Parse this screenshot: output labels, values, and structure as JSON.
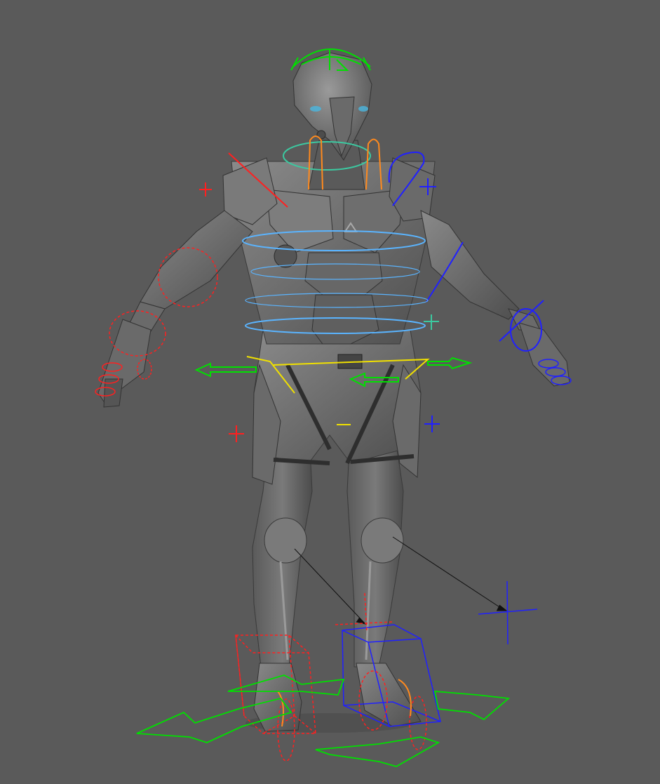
{
  "viewport": {
    "background": "#5a5a5a"
  },
  "model": {
    "name": "armored-character",
    "pose": "A-pose",
    "shading": "grey-matcap"
  },
  "rig_colors": {
    "center": "#00e000",
    "left_side": "#ff2020",
    "right_side": "#2020ff",
    "spine": "#5ab4ff",
    "fk_neck": "#3cc8a0",
    "clavicle": "#ff8a1e",
    "hip": "#f0e000",
    "knee_pole_line": "#101010"
  },
  "controls": [
    "head-ctrl",
    "neck-ctrl",
    "clavicle-l-ctrl",
    "clavicle-r-ctrl",
    "shoulder-l-ctrl",
    "shoulder-r-ctrl",
    "elbow-l-ctrl",
    "elbow-r-ctrl",
    "wrist-l-ctrl",
    "wrist-r-ctrl",
    "fingers-l-ctrl",
    "fingers-r-ctrl",
    "spine-ctrls",
    "chest-ctrl",
    "hip-ctrl",
    "cog-ctrl",
    "knee-pole-l",
    "knee-pole-r",
    "foot-ik-l",
    "foot-ik-r",
    "world-ctrl-l",
    "world-ctrl-r",
    "pv-locator-r"
  ]
}
